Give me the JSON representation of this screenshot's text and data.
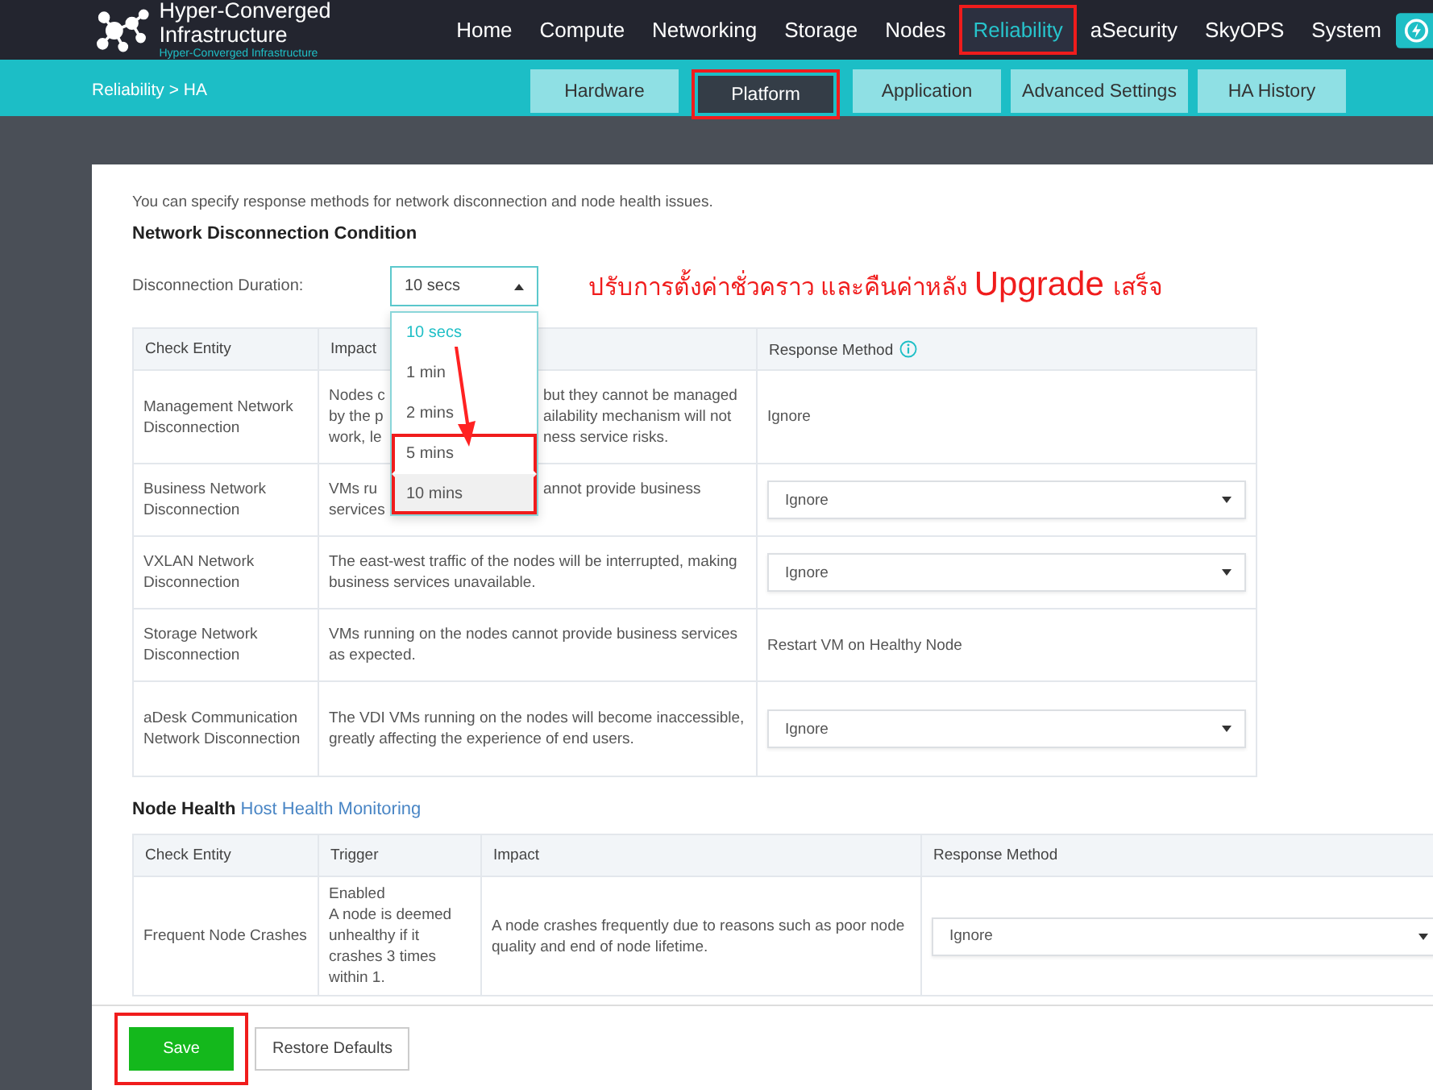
{
  "header": {
    "title": "Hyper-Converged Infrastructure",
    "subtitle": "Hyper-Converged Infrastructure",
    "nav": [
      {
        "label": "Home",
        "selected": false,
        "highlighted": false
      },
      {
        "label": "Compute",
        "selected": false,
        "highlighted": false
      },
      {
        "label": "Networking",
        "selected": false,
        "highlighted": false
      },
      {
        "label": "Storage",
        "selected": false,
        "highlighted": false
      },
      {
        "label": "Nodes",
        "selected": false,
        "highlighted": false
      },
      {
        "label": "Reliability",
        "selected": true,
        "highlighted": true
      },
      {
        "label": "aSecurity",
        "selected": false,
        "highlighted": false
      },
      {
        "label": "SkyOPS",
        "selected": false,
        "highlighted": false
      },
      {
        "label": "System",
        "selected": false,
        "highlighted": false
      }
    ]
  },
  "breadcrumb": "Reliability  > HA",
  "tabs": [
    {
      "label": "Hardware",
      "selected": false,
      "highlighted": false
    },
    {
      "label": "Platform",
      "selected": true,
      "highlighted": true
    },
    {
      "label": "Application",
      "selected": false,
      "highlighted": false
    },
    {
      "label": "Advanced Settings",
      "selected": false,
      "highlighted": false
    },
    {
      "label": "HA History",
      "selected": false,
      "highlighted": false
    }
  ],
  "intro": "You can specify response methods for network disconnection and node health issues.",
  "network": {
    "heading": "Network Disconnection Condition",
    "duration_label": "Disconnection Duration:",
    "duration_value": "10 secs",
    "options": [
      {
        "label": "10 secs",
        "selected": true,
        "hovered": false,
        "highlighted": false
      },
      {
        "label": "1 min",
        "selected": false,
        "hovered": false,
        "highlighted": false
      },
      {
        "label": "2 mins",
        "selected": false,
        "hovered": false,
        "highlighted": false
      },
      {
        "label": "5 mins",
        "selected": false,
        "hovered": false,
        "highlighted": true
      },
      {
        "label": "10 mins",
        "selected": false,
        "hovered": true,
        "highlighted": true
      }
    ],
    "columns": [
      "Check Entity",
      "Impact",
      "Response Method"
    ],
    "rows": [
      {
        "entity": "Management Network Disconnection",
        "impact_left": [
          "Nodes c",
          "by the p",
          "work, le"
        ],
        "impact_right": [
          "but they cannot be managed",
          "ailability mechanism will not",
          "ness service risks."
        ],
        "response": {
          "kind": "text",
          "value": "Ignore"
        }
      },
      {
        "entity": "Business Network Disconnection",
        "impact_left": [
          "VMs ru",
          "services"
        ],
        "impact_right": [
          "annot provide business"
        ],
        "response": {
          "kind": "select",
          "value": "Ignore"
        }
      },
      {
        "entity": "VXLAN Network Disconnection",
        "impact": "The east-west traffic of the nodes will be interrupted, making business services unavailable.",
        "response": {
          "kind": "select",
          "value": "Ignore"
        }
      },
      {
        "entity": "Storage Network Disconnection",
        "impact": "VMs running on the nodes cannot provide business services as expected.",
        "response": {
          "kind": "text",
          "value": "Restart VM on Healthy Node"
        }
      },
      {
        "entity": "aDesk Communication Network Disconnection",
        "impact": "The VDI VMs running on the nodes will become inaccessible, greatly affecting the experience of end users.",
        "response": {
          "kind": "select",
          "value": "Ignore"
        }
      }
    ]
  },
  "annotation": [
    {
      "text": "ปรับการตั้งค่าชั่วคราว และคืนค่าหลัง",
      "emphasis": false
    },
    {
      "text": "Upgrade",
      "emphasis": true
    },
    {
      "text": "เสร็จ",
      "emphasis": false
    }
  ],
  "node_health": {
    "heading": "Node Health",
    "link": "Host Health Monitoring",
    "columns": [
      "Check Entity",
      "Trigger",
      "Impact",
      "Response Method"
    ],
    "rows": [
      {
        "entity": "Frequent Node Crashes",
        "trigger_status": "Enabled",
        "trigger": "A node is deemed unhealthy if it crashes 3 times within 1.",
        "impact": "A node crashes frequently due to reasons such as poor node quality and end of node lifetime.",
        "response": {
          "kind": "select",
          "value": "Ignore"
        }
      }
    ]
  },
  "footer": {
    "save": {
      "label": "Save",
      "highlighted": true
    },
    "restore": "Restore Defaults"
  }
}
